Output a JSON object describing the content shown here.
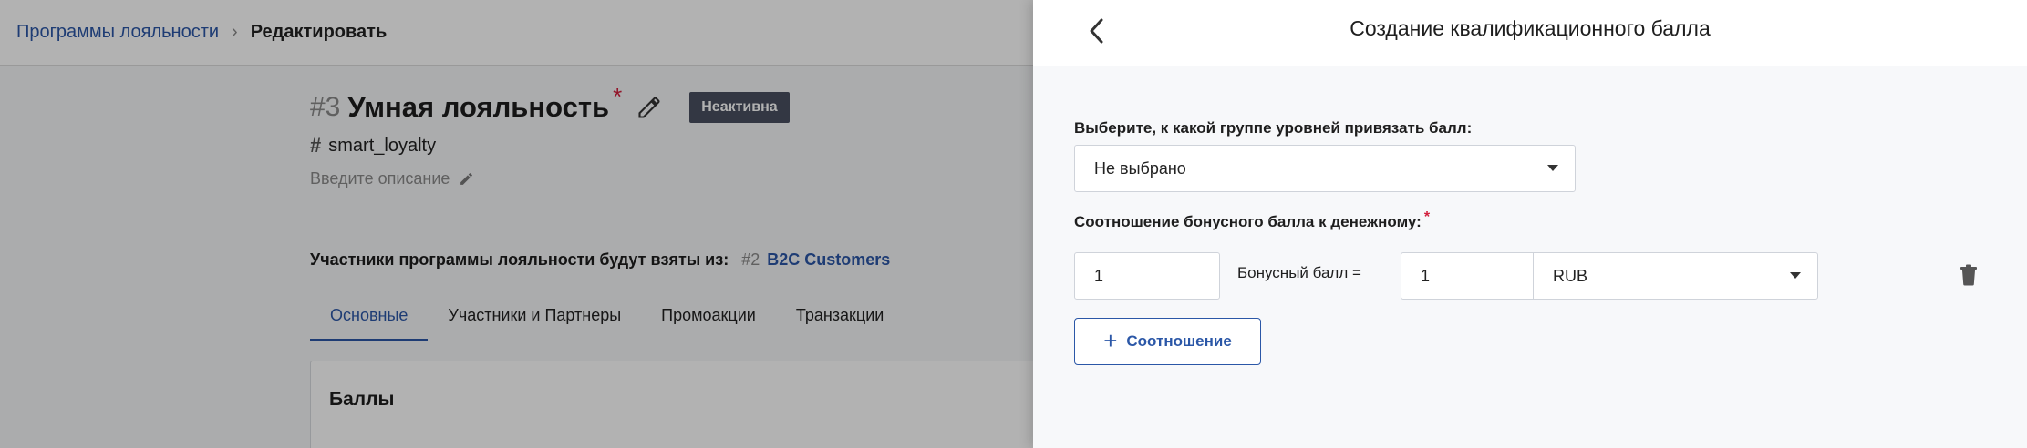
{
  "breadcrumb": {
    "parent": "Программы лояльности",
    "separator": "›",
    "current": "Редактировать"
  },
  "program": {
    "number": "#3",
    "name": "Умная лояльность",
    "status": "Неактивна",
    "code": "smart_loyalty",
    "description_placeholder": "Введите описание",
    "participants_label": "Участники программы лояльности будут взяты из:",
    "participants_number": "#2",
    "participants_source": "B2C Customers"
  },
  "tabs": [
    {
      "label": "Основные",
      "active": true
    },
    {
      "label": "Участники и Партнеры",
      "active": false
    },
    {
      "label": "Промоакции",
      "active": false
    },
    {
      "label": "Транзакции",
      "active": false
    }
  ],
  "card": {
    "title": "Баллы"
  },
  "drawer": {
    "title": "Создание квалификационного балла",
    "level_group_label": "Выберите, к какой группе уровней привязать балл:",
    "level_group_value": "Не выбрано",
    "ratio_label": "Соотношение бонусного балла к денежному:",
    "bonus_value": "1",
    "equals_label": "Бонусный балл =",
    "money_value": "1",
    "currency_value": "RUB",
    "add_ratio_label": "Соотношение"
  },
  "colors": {
    "accent": "#2b57a7",
    "required": "#d21f3c",
    "badge": "#4a5060"
  }
}
